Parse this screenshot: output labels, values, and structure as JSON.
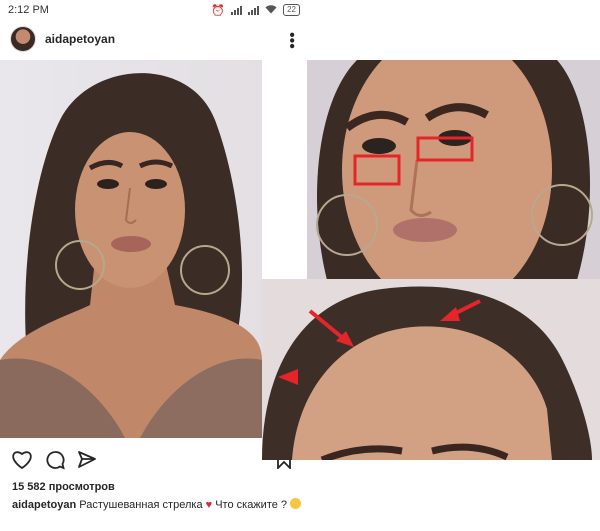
{
  "status_bar": {
    "time": "2:12 PM",
    "network": "4G",
    "battery": "22"
  },
  "post": {
    "username": "aidapetoyan",
    "views": "15 582 просмотров",
    "caption_user": "aidapetoyan",
    "caption_text": "Растушеванная стрелка",
    "caption_text_2": "Что скажите ?"
  },
  "icons": {
    "more": "more-vertical-icon",
    "like": "heart-icon",
    "comment": "comment-icon",
    "share": "send-icon",
    "save": "bookmark-icon"
  },
  "colors": {
    "annotation_red": "#e5252a",
    "text": "#262626"
  }
}
